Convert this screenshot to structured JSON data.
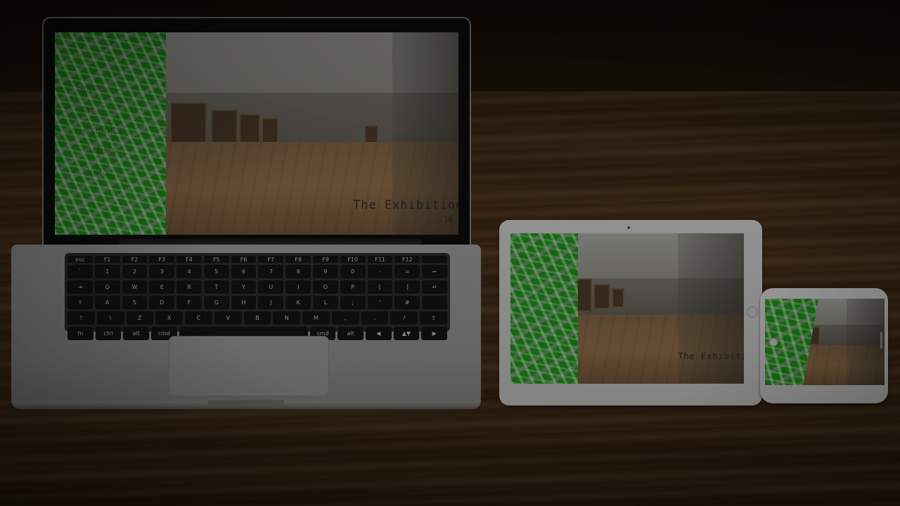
{
  "screen": {
    "title": "The Exhibition",
    "date": "..16",
    "strip_links": [
      "Home",
      "Art",
      "Exhibits",
      "Artists",
      "Info"
    ]
  },
  "laptop": {
    "key_rows": [
      [
        "esc",
        "F1",
        "F2",
        "F3",
        "F4",
        "F5",
        "F6",
        "F7",
        "F8",
        "F9",
        "F10",
        "F11",
        "F12",
        ""
      ],
      [
        "`",
        "1",
        "2",
        "3",
        "4",
        "5",
        "6",
        "7",
        "8",
        "9",
        "0",
        "-",
        "=",
        "←"
      ],
      [
        "⇥",
        "Q",
        "W",
        "E",
        "R",
        "T",
        "Y",
        "U",
        "I",
        "O",
        "P",
        "[",
        "]",
        "↵"
      ],
      [
        "⇪",
        "A",
        "S",
        "D",
        "F",
        "G",
        "H",
        "J",
        "K",
        "L",
        ";",
        "'",
        "#",
        ""
      ],
      [
        "⇧",
        "\\",
        "Z",
        "X",
        "C",
        "V",
        "B",
        "N",
        "M",
        ",",
        ".",
        "/",
        "⇧"
      ],
      [
        "fn",
        "ctrl",
        "alt",
        "cmd",
        "",
        "cmd",
        "alt",
        "◀",
        "▲▼",
        "▶"
      ]
    ]
  },
  "colors": {
    "strip_green": "#1f8f18",
    "desk_wood": "#4a3019",
    "device_silver": "#c9c9c9"
  },
  "icons": [
    "camera-icon",
    "home-button-icon"
  ]
}
